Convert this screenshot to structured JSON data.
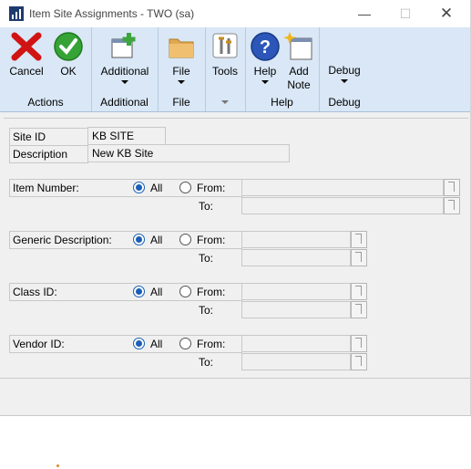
{
  "window": {
    "title": "Item Site Assignments  -  TWO (sa)"
  },
  "ribbon": {
    "cancel": "Cancel",
    "ok": "OK",
    "actions_group": "Actions",
    "additional": "Additional",
    "additional_group": "Additional",
    "file": "File",
    "file_group": "File",
    "tools": "Tools",
    "help": "Help",
    "add_note_1": "Add",
    "add_note_2": "Note",
    "help_group": "Help",
    "debug": "Debug",
    "debug_group": "Debug"
  },
  "form": {
    "site_id_label": "Site ID",
    "site_id_value": "KB SITE",
    "description_label": "Description",
    "description_value": "New KB Site"
  },
  "ranges": [
    {
      "label": "Item Number:",
      "all": "All",
      "from": "From:",
      "to": "To:"
    },
    {
      "label": "Generic Description:",
      "all": "All",
      "from": "From:",
      "to": "To:"
    },
    {
      "label": "Class ID:",
      "all": "All",
      "from": "From:",
      "to": "To:"
    },
    {
      "label": "Vendor ID:",
      "all": "All",
      "from": "From:",
      "to": "To:"
    }
  ]
}
